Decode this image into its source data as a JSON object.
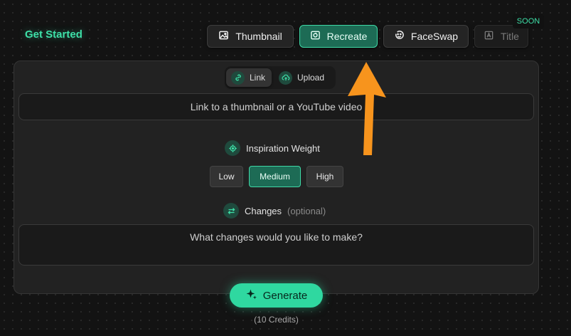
{
  "header": {
    "title": "Get Started"
  },
  "tabs": [
    {
      "label": "Thumbnail",
      "icon": "image-icon"
    },
    {
      "label": "Recreate",
      "icon": "recreate-icon",
      "active": true
    },
    {
      "label": "FaceSwap",
      "icon": "face-icon"
    },
    {
      "label": "Title",
      "icon": "text-box-icon",
      "disabled": true,
      "badge": "SOON"
    }
  ],
  "source": {
    "options": [
      {
        "label": "Link",
        "icon": "link-icon",
        "active": true
      },
      {
        "label": "Upload",
        "icon": "upload-cloud-icon"
      }
    ],
    "placeholder": "Link to a thumbnail or a YouTube video"
  },
  "weight": {
    "label": "Inspiration Weight",
    "options": [
      "Low",
      "Medium",
      "High"
    ],
    "selected": "Medium"
  },
  "changes": {
    "label": "Changes",
    "optional": "(optional)",
    "placeholder": "What changes would you like to make?"
  },
  "generate": {
    "label": "Generate",
    "credits": "(10 Credits)"
  },
  "colors": {
    "accent": "#2fd8a0",
    "accent_dark": "#1d6b55",
    "arrow": "#f7941d"
  }
}
